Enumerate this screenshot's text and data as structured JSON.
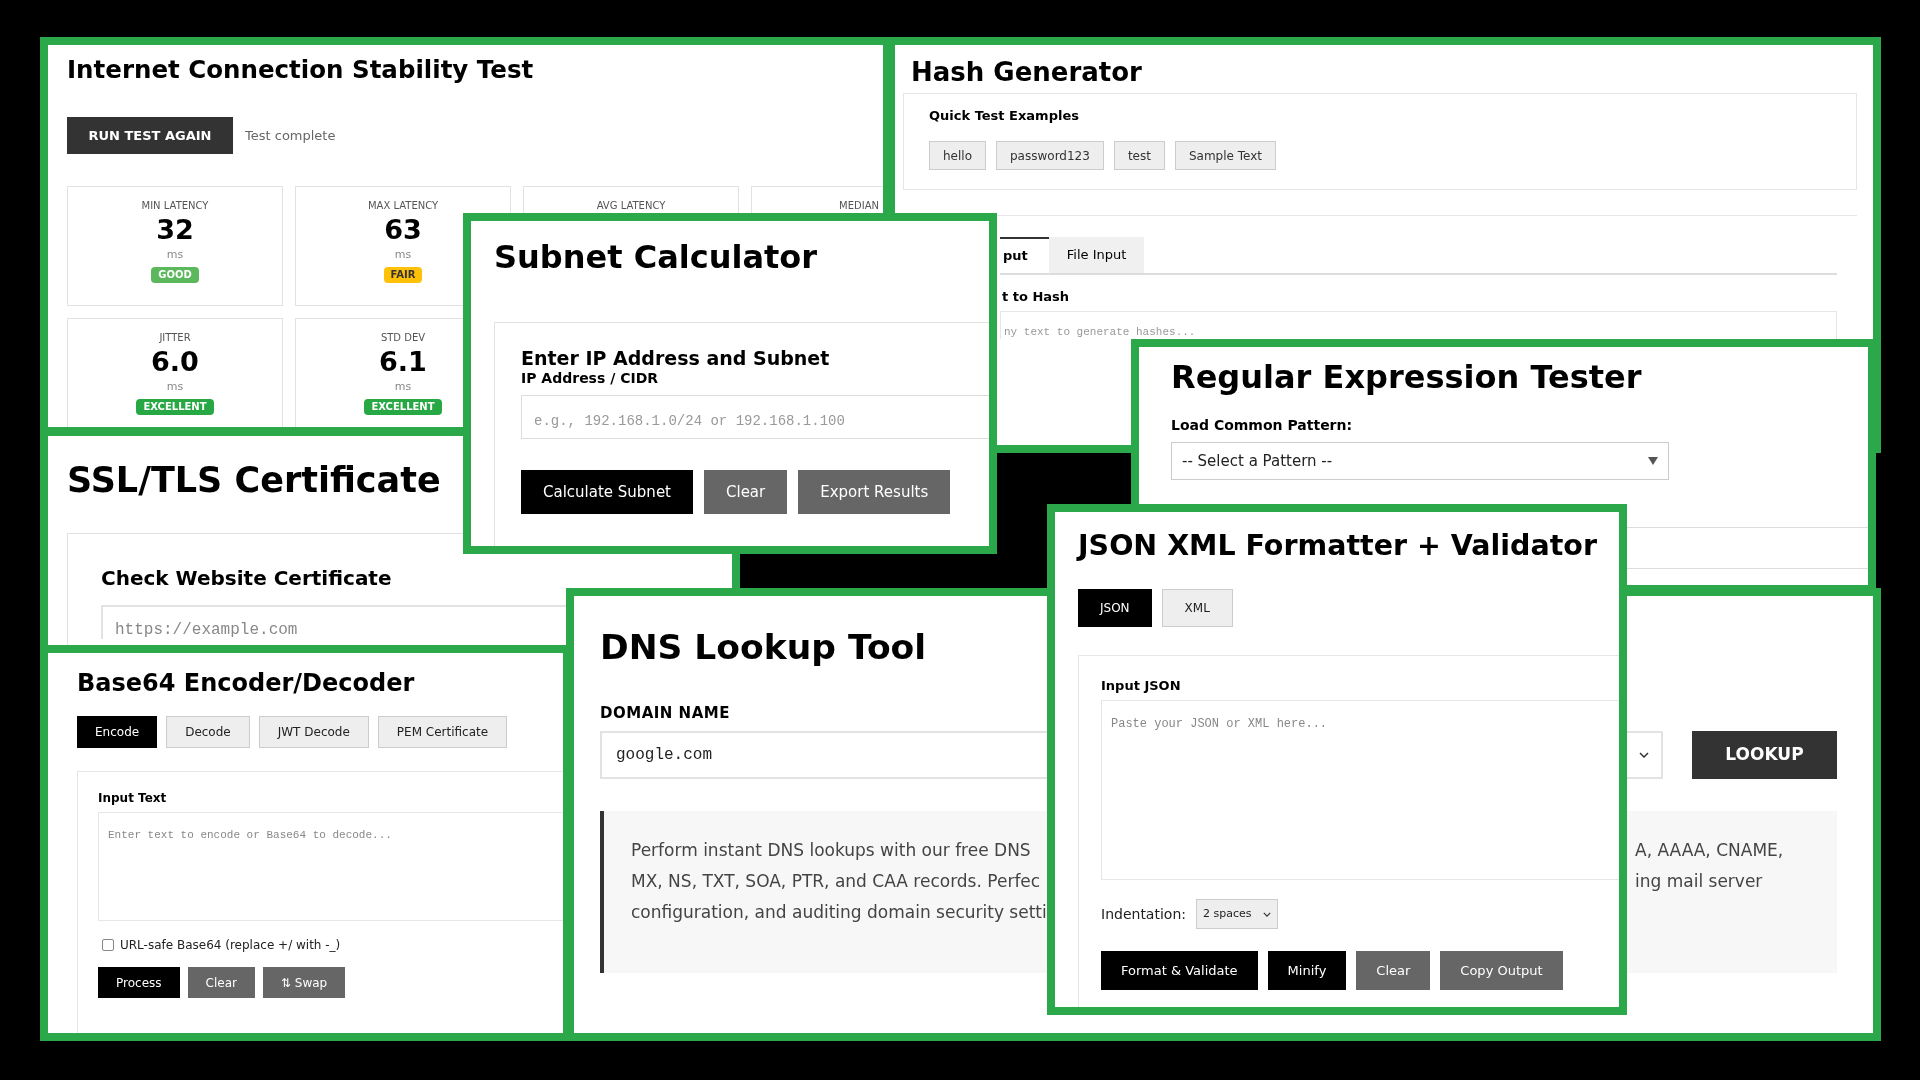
{
  "stability_test": {
    "title": "Internet Connection Stability Test",
    "run_button": "RUN TEST AGAIN",
    "status": "Test complete",
    "cards": [
      {
        "label": "MIN LATENCY",
        "value": "32",
        "unit": "ms",
        "rating": "GOOD",
        "color": "#5cb85c"
      },
      {
        "label": "MAX LATENCY",
        "value": "63",
        "unit": "ms",
        "rating": "FAIR",
        "color": "#ffc107"
      },
      {
        "label": "AVG LATENCY"
      },
      {
        "label": "MEDIAN"
      },
      {
        "label": "JITTER",
        "value": "6.0",
        "unit": "ms",
        "rating": "EXCELLENT",
        "color": "#28a745"
      },
      {
        "label": "STD DEV",
        "value": "6.1",
        "unit": "ms",
        "rating": "EXCELLENT",
        "color": "#28a745"
      }
    ]
  },
  "hash_generator": {
    "title": "Hash Generator",
    "examples_heading": "Quick Test Examples",
    "examples": [
      "hello",
      "password123",
      "test",
      "Sample Text"
    ],
    "tabs": [
      {
        "label": "put",
        "selected": true
      },
      {
        "label": "File Input",
        "selected": false
      }
    ],
    "input_label": "t to Hash",
    "input_placeholder": "ny text to generate hashes..."
  },
  "subnet_calculator": {
    "title": "Subnet Calculator",
    "heading": "Enter IP Address and Subnet",
    "input_label": "IP Address / CIDR",
    "input_placeholder": "e.g., 192.168.1.0/24 or 192.168.1.100",
    "buttons": [
      {
        "label": "Calculate Subnet",
        "kind": "primary"
      },
      {
        "label": "Clear",
        "kind": "secondary"
      },
      {
        "label": "Export Results",
        "kind": "secondary"
      }
    ]
  },
  "ssl_checker": {
    "title": "SSL/TLS Certificate",
    "heading": "Check Website Certificate",
    "url_placeholder": "https://example.com"
  },
  "regex_tester": {
    "title": "Regular Expression Tester",
    "pattern_label": "Load Common Pattern:",
    "pattern_select": "-- Select a Pattern --"
  },
  "base64": {
    "title": "Base64 Encoder/Decoder",
    "tabs": [
      {
        "label": "Encode",
        "selected": true
      },
      {
        "label": "Decode",
        "selected": false
      },
      {
        "label": "JWT Decode",
        "selected": false
      },
      {
        "label": "PEM Certificate",
        "selected": false
      }
    ],
    "input_label": "Input Text",
    "input_placeholder": "Enter text to encode or Base64 to decode...",
    "url_safe": {
      "label": "URL-safe Base64 (replace +/ with -_)",
      "checked": false
    },
    "buttons": [
      {
        "label": "Process",
        "kind": "primary"
      },
      {
        "label": "Clear",
        "kind": "secondary"
      },
      {
        "label": "⇅ Swap",
        "kind": "secondary"
      }
    ]
  },
  "dns_lookup": {
    "title": "DNS Lookup Tool",
    "domain_label": "DOMAIN NAME",
    "domain_value": "google.com",
    "lookup_button": "LOOKUP",
    "description_left": [
      "Perform instant DNS lookups with our free DNS",
      "MX, NS, TXT, SOA, PTR, and CAA records. Perfec",
      "configuration, and auditing domain security setti"
    ],
    "description_right": [
      "A, AAAA, CNAME,",
      "ing mail server"
    ]
  },
  "json_formatter": {
    "title": "JSON XML Formatter + Validator",
    "tabs": [
      {
        "label": "JSON",
        "selected": true
      },
      {
        "label": "XML",
        "selected": false
      }
    ],
    "input_label": "Input JSON",
    "input_placeholder": "Paste your JSON or XML here...",
    "indentation_label": "Indentation:",
    "indentation_value": "2 spaces",
    "buttons": [
      {
        "label": "Format & Validate",
        "kind": "primary"
      },
      {
        "label": "Minify",
        "kind": "primary"
      },
      {
        "label": "Clear",
        "kind": "secondary"
      },
      {
        "label": "Copy Output",
        "kind": "secondary"
      }
    ]
  }
}
